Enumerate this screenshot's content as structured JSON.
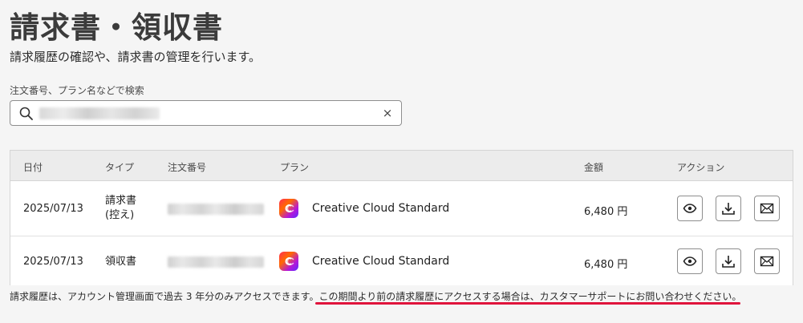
{
  "page": {
    "title": "請求書・領収書",
    "subtitle": "請求履歴の確認や、請求書の管理を行います。"
  },
  "search": {
    "label": "注文番号、プラン名などで検索",
    "value": "",
    "clear_label": "×"
  },
  "table": {
    "headers": {
      "date": "日付",
      "type": "タイプ",
      "order": "注文番号",
      "plan": "プラン",
      "amount": "金額",
      "actions": "アクション"
    },
    "rows": [
      {
        "date": "2025/07/13",
        "type_line1": "請求書",
        "type_line2": "(控え)",
        "order": "",
        "plan": "Creative Cloud Standard",
        "amount": "6,480 円"
      },
      {
        "date": "2025/07/13",
        "type_line1": "領収書",
        "type_line2": "",
        "order": "",
        "plan": "Creative Cloud Standard",
        "amount": "6,480 円"
      }
    ]
  },
  "footer": {
    "note_plain": "請求履歴は、アカウント管理画面で過去 3 年分のみアクセスできます。",
    "note_highlight": "この期間より前の請求履歴にアクセスする場合は、カスタマーサポートにお問い合わせください。"
  },
  "colors": {
    "highlight_underline": "#e0143c",
    "header_bg": "#ececec"
  },
  "icons": {
    "search": "search-icon",
    "clear": "close-icon",
    "plan": "creative-cloud-icon",
    "view": "eye-icon",
    "download": "download-icon",
    "email": "mail-icon"
  }
}
